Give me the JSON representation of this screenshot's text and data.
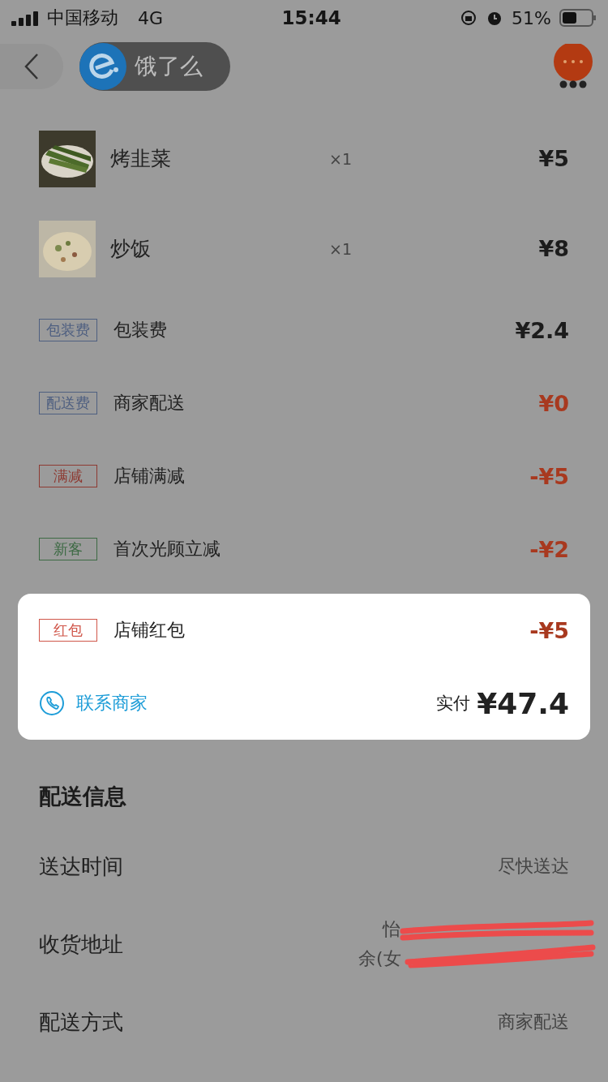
{
  "status_bar": {
    "carrier": "中国移动",
    "network": "4G",
    "time": "15:44",
    "battery": "51%"
  },
  "nav": {
    "app_name": "饿了么"
  },
  "dishes": [
    {
      "name": "烤韭菜",
      "qty": "×1",
      "price": "¥5",
      "kind": "picture"
    },
    {
      "name": "炒饭",
      "qty": "×1",
      "price": "¥8",
      "kind": "picture"
    }
  ],
  "fees": [
    {
      "tag": "包装费",
      "color": "#4e5f80",
      "label": "包装费",
      "amount": "¥2.4",
      "accent": false
    },
    {
      "tag": "配送费",
      "color": "#4e5f80",
      "label": "商家配送",
      "amount": "¥0",
      "accent": true
    },
    {
      "tag": "满减",
      "color": "#8e3a32",
      "label": "店铺满减",
      "amount": "-¥5",
      "accent": true
    },
    {
      "tag": "新客",
      "color": "#3d6a44",
      "label": "首次光顾立减",
      "amount": "-¥2",
      "accent": true
    }
  ],
  "highlight_card": {
    "fee": {
      "tag": "红包",
      "color": "#d0564a",
      "label": "店铺红包",
      "amount": "-¥5",
      "accent": true
    },
    "contact": "联系商家",
    "total_label": "实付",
    "total": "¥47.4"
  },
  "delivery": {
    "title": "配送信息",
    "rows": [
      {
        "label": "送达时间",
        "value": [
          "尽快送达"
        ],
        "redacted": false
      },
      {
        "label": "收货地址",
        "value": [
          "怡",
          "余(女"
        ],
        "redacted": true
      },
      {
        "label": "配送方式",
        "value": [
          "商家配送"
        ],
        "redacted": false
      }
    ]
  }
}
